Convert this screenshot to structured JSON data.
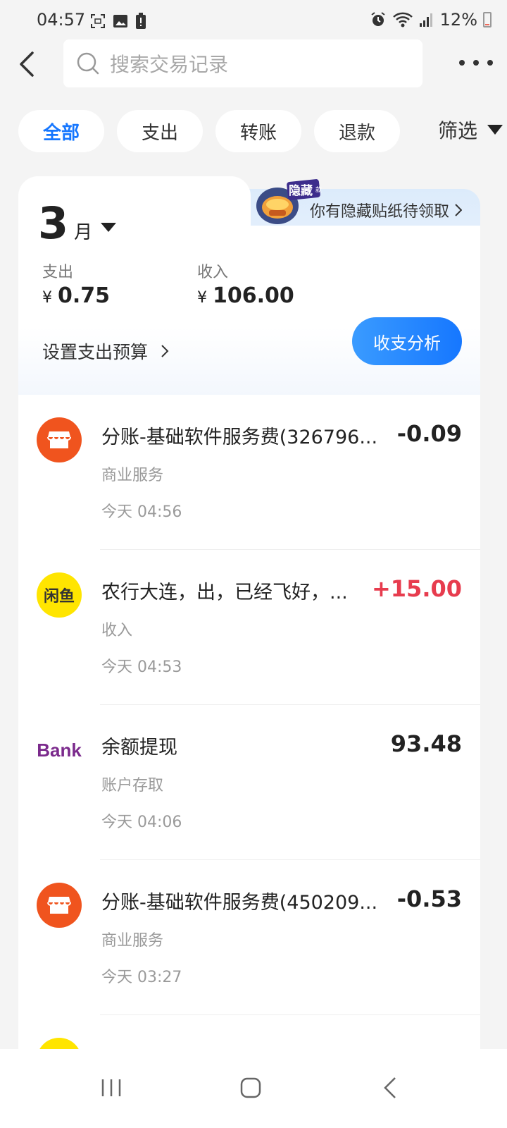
{
  "status_bar": {
    "time": "04:57",
    "battery": "12%",
    "battery_level": 0.12
  },
  "search": {
    "placeholder": "搜索交易记录"
  },
  "filters": {
    "chips": [
      "全部",
      "支出",
      "转账",
      "退款"
    ],
    "active": "全部",
    "filter_label": "筛选"
  },
  "summary": {
    "month_num": "3",
    "month_unit": "月",
    "expense_label": "支出",
    "expense_currency": "¥",
    "expense_value": "0.75",
    "income_label": "收入",
    "income_currency": "¥",
    "income_value": "106.00",
    "budget_link": "设置支出预算",
    "analysis_button": "收支分析",
    "sticker_badge": "隐藏",
    "sticker_badge_suffix": "款",
    "sticker_text": "你有隐藏贴纸待领取"
  },
  "transactions": [
    {
      "title": "分账-基础软件服务费(326796...",
      "amount": "-0.09",
      "category": "商业服务",
      "time": "今天 04:56",
      "icon": "store-icon"
    },
    {
      "title": "农行大连，出，已经飞好，...",
      "amount": "+15.00",
      "category": "收入",
      "time": "今天 04:53",
      "icon": "xianyu-logo",
      "logo_text": "闲鱼"
    },
    {
      "title": "余额提现",
      "amount": "93.48",
      "category": "账户存取",
      "time": "今天 04:06",
      "icon": "bank-logo",
      "logo_text": "Bank"
    },
    {
      "title": "分账-基础软件服务费(450209...",
      "amount": "-0.53",
      "category": "商业服务",
      "time": "今天 03:27",
      "icon": "store-icon"
    }
  ],
  "colors": {
    "accent": "#1677ff",
    "income": "#e73c4e",
    "store": "#f0541e",
    "xianyu": "#ffe500"
  }
}
